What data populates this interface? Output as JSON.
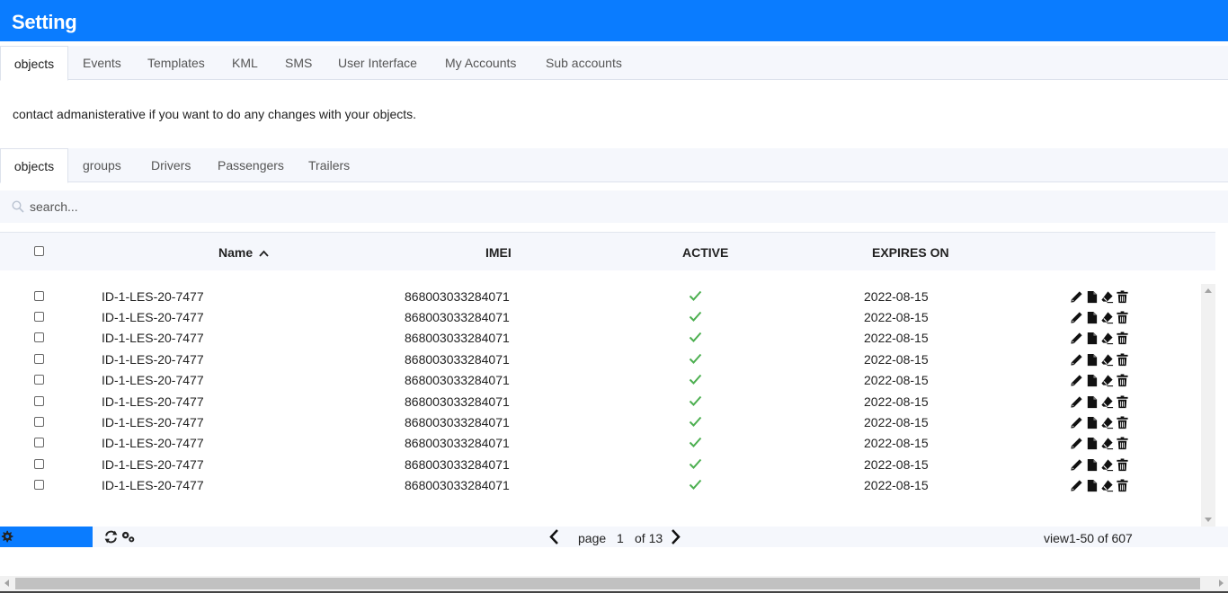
{
  "app": {
    "title": "Setting"
  },
  "top_tabs": [
    {
      "label": "objects",
      "active": true
    },
    {
      "label": "Events"
    },
    {
      "label": "Templates"
    },
    {
      "label": "KML"
    },
    {
      "label": "SMS"
    },
    {
      "label": "User Interface"
    },
    {
      "label": "My Accounts"
    },
    {
      "label": "Sub accounts"
    }
  ],
  "notice": "contact admanisterative if you want to do any changes with your objects.",
  "sub_tabs": [
    {
      "label": "objects",
      "active": true
    },
    {
      "label": "groups"
    },
    {
      "label": "Drivers"
    },
    {
      "label": "Passengers"
    },
    {
      "label": "Trailers"
    }
  ],
  "search": {
    "placeholder": "search...",
    "value": "",
    "icon": "search-icon"
  },
  "table": {
    "columns": [
      {
        "label": "Name",
        "sort": "ascending",
        "sort_icon": "chevron-up-icon"
      },
      {
        "label": "IMEI"
      },
      {
        "label": "ACTIVE"
      },
      {
        "label": "EXPIRES ON"
      }
    ],
    "rows": [
      {
        "name": "ID-1-LES-20-7477",
        "imei": "868003033284071",
        "active": true,
        "expires": "2022-08-15"
      },
      {
        "name": "ID-1-LES-20-7477",
        "imei": "868003033284071",
        "active": true,
        "expires": "2022-08-15"
      },
      {
        "name": "ID-1-LES-20-7477",
        "imei": "868003033284071",
        "active": true,
        "expires": "2022-08-15"
      },
      {
        "name": "ID-1-LES-20-7477",
        "imei": "868003033284071",
        "active": true,
        "expires": "2022-08-15"
      },
      {
        "name": "ID-1-LES-20-7477",
        "imei": "868003033284071",
        "active": true,
        "expires": "2022-08-15"
      },
      {
        "name": "ID-1-LES-20-7477",
        "imei": "868003033284071",
        "active": true,
        "expires": "2022-08-15"
      },
      {
        "name": "ID-1-LES-20-7477",
        "imei": "868003033284071",
        "active": true,
        "expires": "2022-08-15"
      },
      {
        "name": "ID-1-LES-20-7477",
        "imei": "868003033284071",
        "active": true,
        "expires": "2022-08-15"
      },
      {
        "name": "ID-1-LES-20-7477",
        "imei": "868003033284071",
        "active": true,
        "expires": "2022-08-15"
      },
      {
        "name": "ID-1-LES-20-7477",
        "imei": "868003033284071",
        "active": true,
        "expires": "2022-08-15"
      }
    ],
    "row_action_icons": [
      "pencil-icon",
      "file-icon",
      "eraser-icon",
      "trash-icon"
    ],
    "active_icon": "checkmark-icon"
  },
  "pagination": {
    "page_label": "page",
    "current_page": "1",
    "of_label": "of 13",
    "view_summary": "view1-50 of 607",
    "icons": [
      "gear-icon",
      "refresh-icon",
      "gears-icon",
      "chevron-left-icon",
      "chevron-right-icon"
    ]
  },
  "colors": {
    "brand": "#0a7cff",
    "tab_background": "#f5f7fc",
    "active_check": "#4caf50",
    "text": "#222222"
  }
}
